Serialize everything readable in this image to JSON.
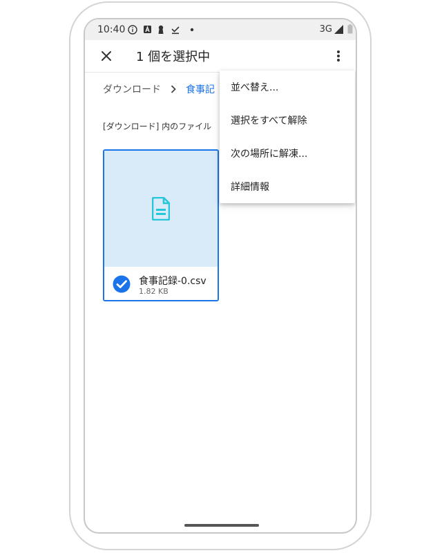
{
  "status_bar": {
    "time": "10:40",
    "network": "3G",
    "icons": [
      "info-icon",
      "a-badge-icon",
      "keyhole-icon",
      "download-done-icon",
      "dot-icon",
      "signal-icon",
      "battery-icon"
    ]
  },
  "app_bar": {
    "title": "1 個を選択中",
    "close_icon": "close-icon",
    "more_icon": "more-vert-icon"
  },
  "breadcrumb": {
    "root": "ダウンロード",
    "separator_icon": "chevron-right-icon",
    "current": "食事記"
  },
  "section_label": "[ダウンロード] 内のファイル",
  "file": {
    "name": "食事記録-0.csv",
    "size": "1.82 KB",
    "icon": "document-icon",
    "selected": true
  },
  "menu": {
    "items": [
      {
        "label": "並べ替え..."
      },
      {
        "label": "選択をすべて解除"
      },
      {
        "label": "次の場所に解凍..."
      },
      {
        "label": "詳細情報"
      }
    ]
  },
  "colors": {
    "accent": "#1a73e8",
    "thumbnail_bg": "#d9eaf9",
    "doc_icon": "#26c6da",
    "status_bar_bg": "#f0f0f0"
  }
}
